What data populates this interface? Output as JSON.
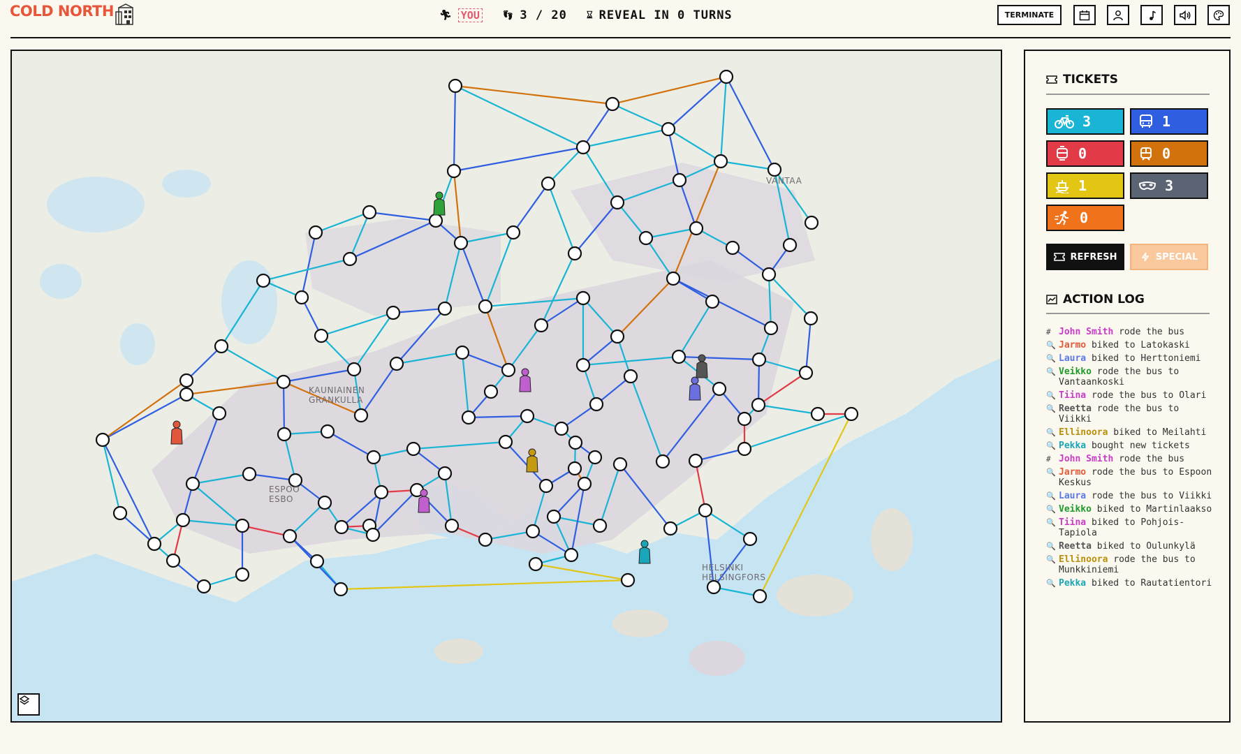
{
  "header": {
    "logo_text": "COLD NORTH",
    "you_label": "YOU",
    "moves": "3 / 20",
    "reveal": "REVEAL IN 0 TURNS",
    "terminate_label": "TERMINATE",
    "icon_buttons": [
      "calendar-icon",
      "user-icon",
      "music-icon",
      "volume-icon",
      "palette-icon"
    ]
  },
  "map": {
    "labels": [
      "VANTAA",
      "KAUNIAINEN",
      "GRANKULLA",
      "ESPOO",
      "ESBO",
      "HELSINKI",
      "HELSINGFORS"
    ]
  },
  "tickets": {
    "title": "TICKETS",
    "items": [
      {
        "type": "bike",
        "count": "3",
        "color": "#1ab4d4"
      },
      {
        "type": "bus",
        "count": "1",
        "color": "#2f5fe0"
      },
      {
        "type": "tram",
        "count": "0",
        "color": "#e23b47"
      },
      {
        "type": "train",
        "count": "0",
        "color": "#d2720c"
      },
      {
        "type": "ferry",
        "count": "1",
        "color": "#e3c514"
      },
      {
        "type": "mask",
        "count": "3",
        "color": "#5b6472"
      },
      {
        "type": "run",
        "count": "0",
        "color": "#f0731c"
      }
    ],
    "refresh_label": "REFRESH",
    "special_label": "SPECIAL"
  },
  "action_log": {
    "title": "ACTION LOG",
    "entries": [
      {
        "icon": "#",
        "who": "John Smith",
        "color": "#c83cc8",
        "text": " rode the bus"
      },
      {
        "icon": "🔍",
        "who": "Jarmo",
        "color": "#e25a3a",
        "text": " biked to Latokaski"
      },
      {
        "icon": "🔍",
        "who": "Laura",
        "color": "#5a78e8",
        "text": " biked to Herttoniemi"
      },
      {
        "icon": "🔍",
        "who": "Veikko",
        "color": "#1f9a2a",
        "text": " rode the bus to Vantaankoski"
      },
      {
        "icon": "🔍",
        "who": "Tiina",
        "color": "#c83cc8",
        "text": " rode the bus to Olari"
      },
      {
        "icon": "🔍",
        "who": "Reetta",
        "color": "#555555",
        "text": " rode the bus to Viikki"
      },
      {
        "icon": "🔍",
        "who": "Ellinoora",
        "color": "#b8900a",
        "text": " biked to Meilahti"
      },
      {
        "icon": "🔍",
        "who": "Pekka",
        "color": "#1aa6b8",
        "text": " bought new tickets"
      },
      {
        "icon": "#",
        "who": "John Smith",
        "color": "#c83cc8",
        "text": " rode the bus"
      },
      {
        "icon": "🔍",
        "who": "Jarmo",
        "color": "#e25a3a",
        "text": " rode the bus to Espoon Keskus"
      },
      {
        "icon": "🔍",
        "who": "Laura",
        "color": "#5a78e8",
        "text": " rode the bus to Viikki"
      },
      {
        "icon": "🔍",
        "who": "Veikko",
        "color": "#1f9a2a",
        "text": " biked to Martinlaakso"
      },
      {
        "icon": "🔍",
        "who": "Tiina",
        "color": "#c83cc8",
        "text": " biked to Pohjois-Tapiola"
      },
      {
        "icon": "🔍",
        "who": "Reetta",
        "color": "#555555",
        "text": " biked to Oulunkylä"
      },
      {
        "icon": "🔍",
        "who": "Ellinoora",
        "color": "#b8900a",
        "text": " rode the bus to Munkkiniemi"
      },
      {
        "icon": "🔍",
        "who": "Pekka",
        "color": "#1aa6b8",
        "text": " biked to Rautatientori"
      }
    ]
  }
}
